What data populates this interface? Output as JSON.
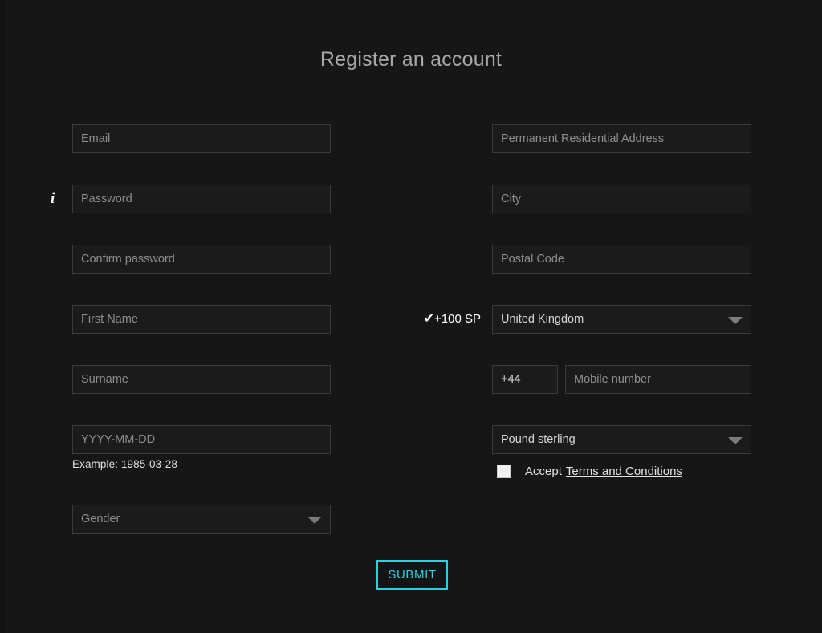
{
  "page": {
    "title": "Register an account",
    "background_color": "#161616",
    "accent_color": "#29d2e0"
  },
  "left_column": {
    "email": {
      "placeholder": "Email",
      "value": ""
    },
    "password": {
      "placeholder": "Password",
      "value": "",
      "info_icon": "info-icon",
      "info_glyph": "i"
    },
    "confirm_password": {
      "placeholder": "Confirm password",
      "value": ""
    },
    "first_name": {
      "placeholder": "First Name",
      "value": ""
    },
    "surname": {
      "placeholder": "Surname",
      "value": ""
    },
    "birth_date": {
      "placeholder": "YYYY-MM-DD",
      "value": "",
      "hint": "Example: 1985-03-28"
    },
    "gender": {
      "selected": "Gender",
      "is_placeholder": true,
      "caret_icon": "chevron-down-icon"
    }
  },
  "right_column": {
    "address": {
      "placeholder": "Permanent Residential Address",
      "value": ""
    },
    "city": {
      "placeholder": "City",
      "value": ""
    },
    "postal_code": {
      "placeholder": "Postal Code",
      "value": ""
    },
    "country": {
      "selected": "United Kingdom",
      "is_placeholder": false,
      "caret_icon": "chevron-down-icon",
      "reward_check_glyph": "✔",
      "reward_label": "+100 SP"
    },
    "phone": {
      "country_code": "+44",
      "number_placeholder": "Mobile number",
      "number_value": ""
    },
    "currency": {
      "selected": "Pound sterling",
      "is_placeholder": false,
      "caret_icon": "chevron-down-icon"
    },
    "terms": {
      "checked": false,
      "accept_label": "Accept",
      "link_label": "Terms and Conditions"
    }
  },
  "submit": {
    "label": "SUBMIT"
  }
}
